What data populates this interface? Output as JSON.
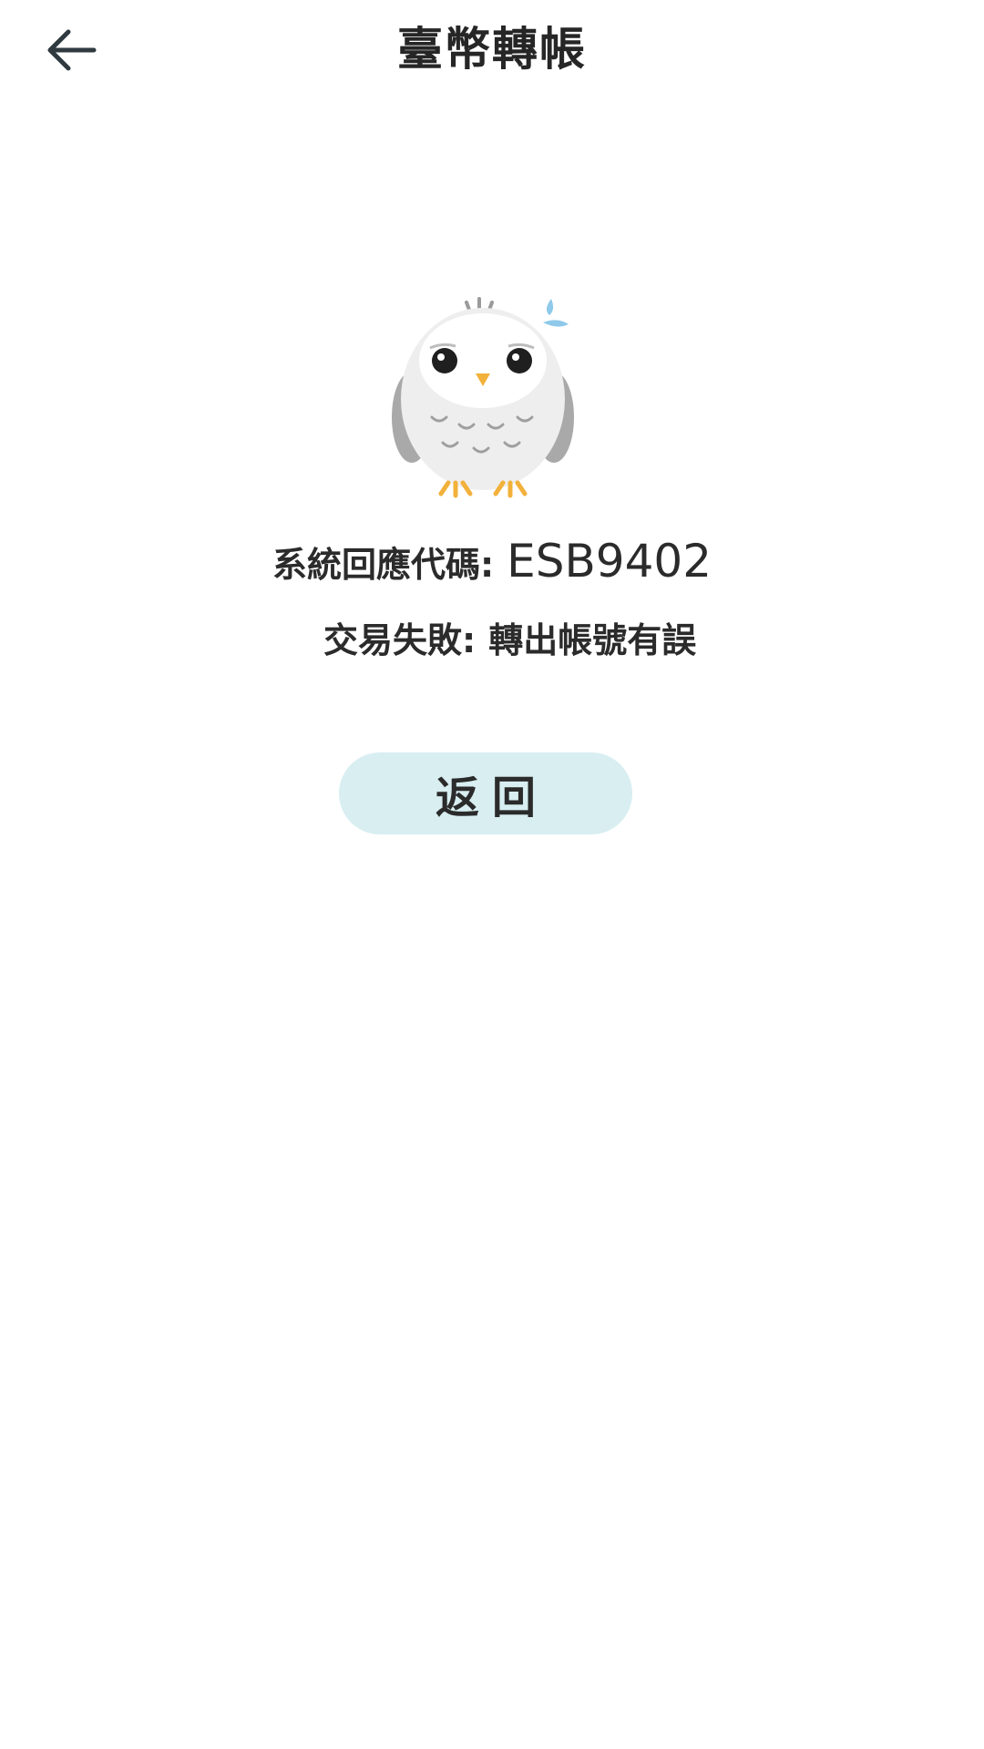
{
  "header": {
    "title": "臺幣轉帳",
    "back_icon": "arrow-left-icon"
  },
  "mascot": {
    "icon": "sweating-owl-illustration"
  },
  "result": {
    "code_label": "系統回應代碼:",
    "code_value": "ESB9402",
    "message_label": "交易失敗:",
    "message_value": "轉出帳號有誤"
  },
  "actions": {
    "return_label": "返回"
  },
  "colors": {
    "button_bg": "#d8eef1",
    "text": "#2b2b2b",
    "background": "#ffffff"
  }
}
